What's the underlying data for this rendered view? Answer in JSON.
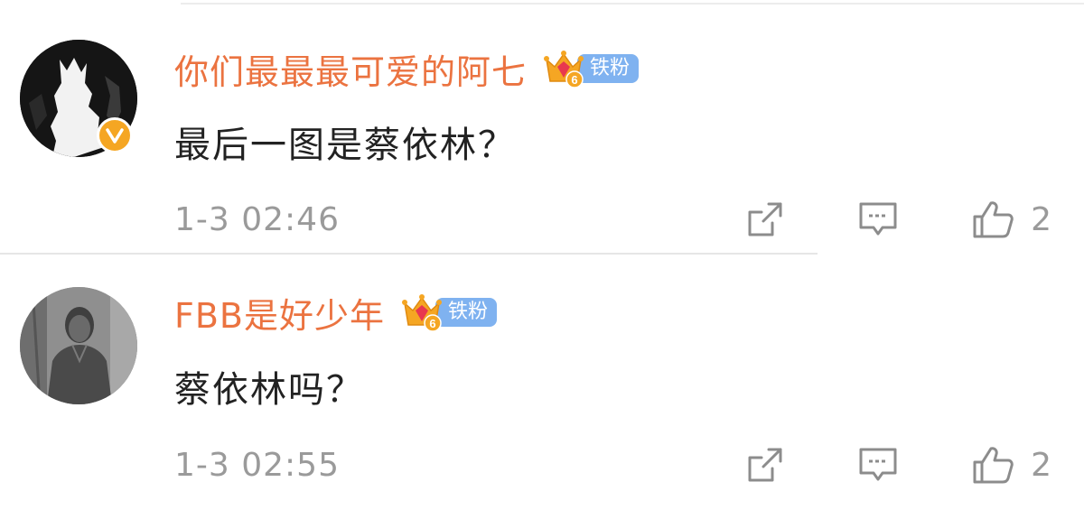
{
  "comments": [
    {
      "username": "你们最最最可爱的阿七",
      "fan_level": "6",
      "fan_badge": "铁粉",
      "verified": true,
      "text": "最后一图是蔡依林？",
      "time": "1-3  02:46",
      "likes": "2",
      "avatar_icon": "avatar-silhouette-icon"
    },
    {
      "username": "FBB是好少年",
      "fan_level": "6",
      "fan_badge": "铁粉",
      "verified": false,
      "text": "蔡依林吗？",
      "time": "1-3  02:55",
      "likes": "2",
      "avatar_icon": "avatar-photo-icon"
    }
  ],
  "icons": {
    "share": "share-icon",
    "comment": "comment-icon",
    "like": "thumbs-up-icon"
  },
  "colors": {
    "username": "#eb7340",
    "fan_badge": "#7fb2f0",
    "crown": "#f5a623",
    "verified": "#f5a623",
    "muted": "#9a9a9a",
    "text": "#222222"
  }
}
